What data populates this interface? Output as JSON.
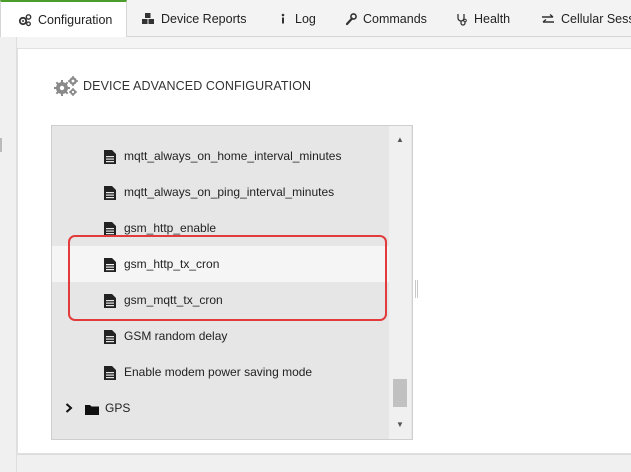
{
  "tabs": [
    {
      "label": "Configuration",
      "icon": "cogs-icon",
      "active": true
    },
    {
      "label": "Device Reports",
      "icon": "cubes-icon"
    },
    {
      "label": "Log",
      "icon": "info-icon"
    },
    {
      "label": "Commands",
      "icon": "wrench-icon"
    },
    {
      "label": "Health",
      "icon": "stethoscope-icon"
    },
    {
      "label": "Cellular Sessi",
      "icon": "exchange-arrows-icon"
    }
  ],
  "section": {
    "title": "DEVICE ADVANCED CONFIGURATION",
    "icon": "gears-icon"
  },
  "tree": {
    "items": [
      {
        "label": "mqtt_always_on_home_interval_minutes",
        "icon": "file-icon"
      },
      {
        "label": "mqtt_always_on_ping_interval_minutes",
        "icon": "file-icon"
      },
      {
        "label": "gsm_http_enable",
        "icon": "file-icon"
      },
      {
        "label": "gsm_http_tx_cron",
        "icon": "file-icon",
        "highlighted": true
      },
      {
        "label": "gsm_mqtt_tx_cron",
        "icon": "file-icon",
        "highlighted": true
      },
      {
        "label": "GSM random delay",
        "icon": "file-icon"
      },
      {
        "label": "Enable modem power saving mode",
        "icon": "file-icon"
      },
      {
        "label": "GPS",
        "icon": "folder-icon",
        "expand_icon": "chevron-right-icon"
      }
    ]
  },
  "colors": {
    "accent": "#4a9c2b",
    "highlight_box": "#e23b3b",
    "tree_bg": "#e6e6e6"
  }
}
